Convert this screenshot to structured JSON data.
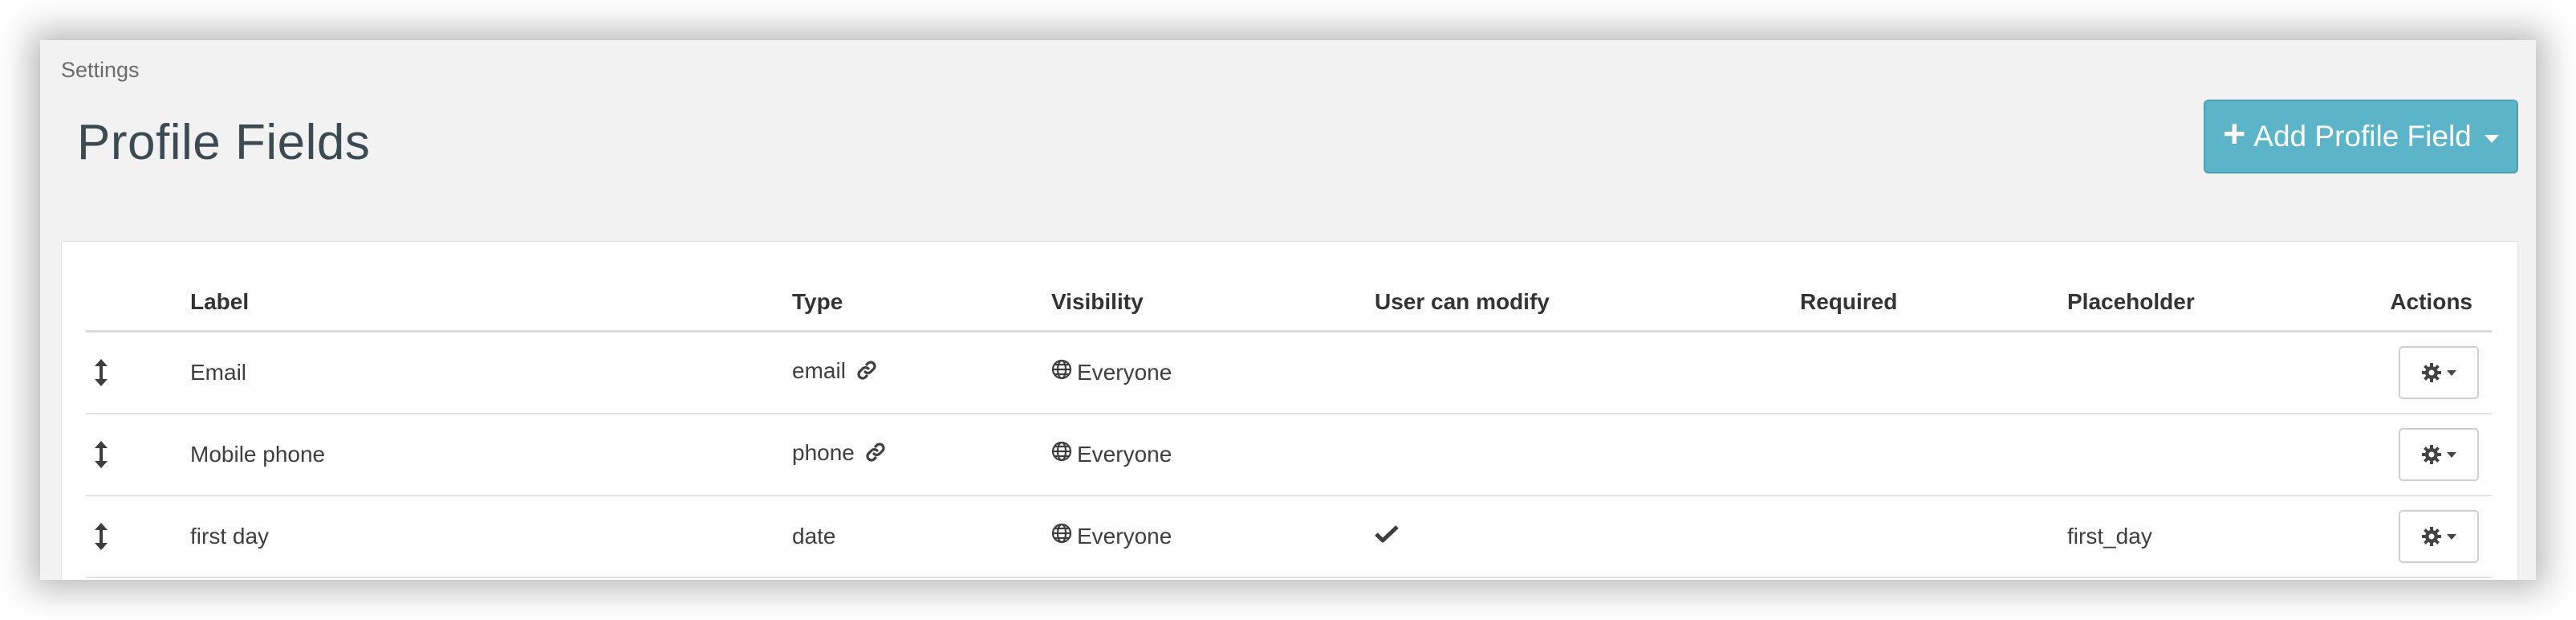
{
  "breadcrumb": "Settings",
  "page_title": "Profile Fields",
  "add_button": {
    "label": "Add Profile Field"
  },
  "table": {
    "headers": {
      "label": "Label",
      "type": "Type",
      "visibility": "Visibility",
      "user_can_modify": "User can modify",
      "required": "Required",
      "placeholder": "Placeholder",
      "actions": "Actions"
    },
    "rows": [
      {
        "label": "Email",
        "type": "email",
        "type_icon": "link-icon",
        "visibility": "Everyone",
        "user_can_modify": false,
        "required": false,
        "placeholder": ""
      },
      {
        "label": "Mobile phone",
        "type": "phone",
        "type_icon": "link-icon",
        "visibility": "Everyone",
        "user_can_modify": false,
        "required": false,
        "placeholder": ""
      },
      {
        "label": "first day",
        "type": "date",
        "type_icon": "",
        "visibility": "Everyone",
        "user_can_modify": true,
        "required": false,
        "placeholder": "first_day"
      }
    ]
  },
  "colors": {
    "accent": "#5bb4c8",
    "background": "#f2f2f2",
    "title": "#3c4a52"
  }
}
